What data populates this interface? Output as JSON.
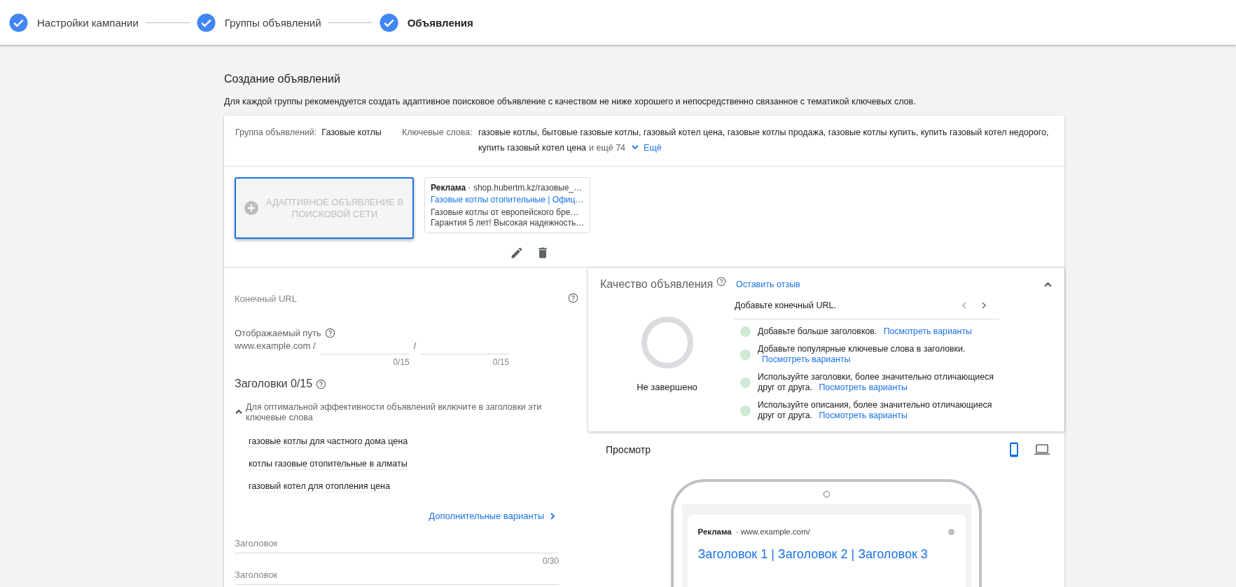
{
  "steps": [
    {
      "label": "Настройки кампании",
      "done": true,
      "selected": false
    },
    {
      "label": "Группы объявлений",
      "done": true,
      "selected": false
    },
    {
      "label": "Объявления",
      "done": true,
      "selected": true
    }
  ],
  "page": {
    "title": "Создание объявлений",
    "description": "Для каждой группы рекомендуется создать адаптивное поисковое объявление с качеством не ниже хорошего и непосредственно связанное с тематикой ключевых слов."
  },
  "ad_group": {
    "label": "Группа объявлений:",
    "value": "Газовые котлы"
  },
  "keywords": {
    "label": "Ключевые слова:",
    "value": "газовые котлы, бытовые газовые котлы, газовый котел цена, газовые котлы продажа, газовые котлы купить, купить газовый котел недорого, купить газовый котел цена",
    "more_count": "и ещё 74",
    "expand": "Ещё"
  },
  "ads": [
    {
      "kind": "new",
      "title": "АДАПТИВНОЕ ОБЪЯВЛЕНИЕ В ПОИСКОВОЙ СЕТИ",
      "selected": true
    },
    {
      "kind": "preview",
      "badge": "Реклама",
      "url": "· shop.hubertm.kz/газовые_…",
      "headline": "Газовые котлы отопительные | Офиц…",
      "lines": [
        "Газовые котлы от европейского бре…",
        "Гарантия 5 лет! Высокая надежность…"
      ],
      "selected": false
    }
  ],
  "form": {
    "final_url": {
      "placeholder": "Конечный URL"
    },
    "display_path": {
      "label": "Отображаемый путь",
      "domain": "www.example.com /",
      "separator": "/",
      "fields": [
        {
          "counter": "0/15"
        },
        {
          "counter": "0/15"
        }
      ]
    },
    "headlines": {
      "title": "Заголовки 0/15",
      "hint": "Для оптимальной эффективности объявлений включите в заголовки эти ключевые слова",
      "expanded": true,
      "suggestions": [
        "газовые котлы для частного дома цена",
        "котлы газовые отопительные в алматы",
        "газовый котел для отопления цена"
      ],
      "more": "Дополнительные варианты",
      "fields": [
        {
          "placeholder": "Заголовок",
          "counter": "0/30"
        },
        {
          "placeholder": "Заголовок"
        }
      ]
    }
  },
  "quality": {
    "title": "Качество объявления",
    "feedback": "Оставить отзыв",
    "expanded": true,
    "tip": "Добавьте конечный URL.",
    "status": "Не завершено",
    "items": [
      {
        "text": "Добавьте больше заголовков.",
        "link": "Посмотреть варианты"
      },
      {
        "text": "Добавьте популярные ключевые слова в заголовки.",
        "link": "Посмотреть варианты"
      },
      {
        "text": "Используйте заголовки, более значительно отличающиеся друг от друга.",
        "link": "Посмотреть варианты"
      },
      {
        "text": "Используйте описания, более значительно отличающиеся друг от друга.",
        "link": "Посмотреть варианты"
      }
    ]
  },
  "preview": {
    "title": "Просмотр",
    "devices": [
      {
        "kind": "mobile",
        "selected": true
      },
      {
        "kind": "desktop",
        "selected": false
      }
    ],
    "ad": {
      "badge": "Реклама",
      "url": "· www.example.com/",
      "headline": "Заголовок 1 | Заголовок 2 | Заголовок 3"
    }
  }
}
